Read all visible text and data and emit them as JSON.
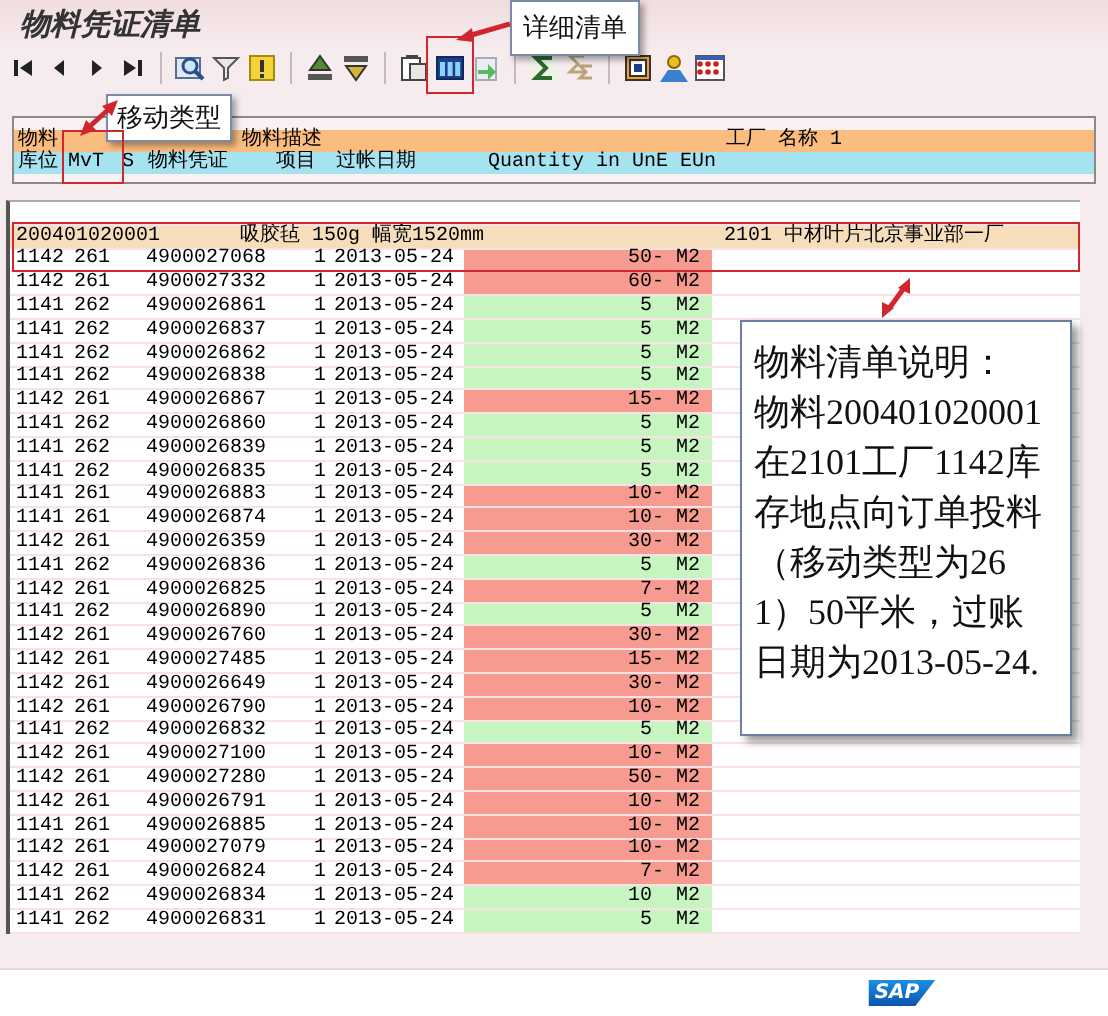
{
  "window": {
    "title": "物料凭证清单"
  },
  "toolbar": [
    {
      "kind": "first"
    },
    {
      "kind": "prev"
    },
    {
      "kind": "next"
    },
    {
      "kind": "last"
    },
    {
      "kind": "separator"
    },
    {
      "kind": "find"
    },
    {
      "kind": "filter"
    },
    {
      "kind": "warning"
    },
    {
      "kind": "separator"
    },
    {
      "kind": "sort-up"
    },
    {
      "kind": "sort-down"
    },
    {
      "kind": "separator"
    },
    {
      "kind": "export"
    },
    {
      "kind": "columns"
    },
    {
      "kind": "refresh"
    },
    {
      "kind": "separator"
    },
    {
      "kind": "sum"
    },
    {
      "kind": "subtotal"
    },
    {
      "kind": "separator"
    },
    {
      "kind": "layout"
    },
    {
      "kind": "person"
    },
    {
      "kind": "grid"
    }
  ],
  "header": {
    "row_1": [
      "物料",
      "物料描述",
      "工厂 名称 1"
    ],
    "row_2": [
      "库位",
      "MvT",
      "S",
      "物料凭证",
      "项目",
      "过帐日期",
      "Quantity in UnE EUn"
    ]
  },
  "group": {
    "material": "200401020001",
    "description": "吸胶毡 150g 幅宽1520mm",
    "plant": "2101 中材叶片北京事业部一厂"
  },
  "rows": [
    {
      "storage_location": "1142",
      "movement_type": "261",
      "document": "4900027068",
      "item": "1",
      "posting_date": "2013-05-24",
      "quantity": "50-",
      "unit": "M2",
      "color": "#f79a8f"
    },
    {
      "storage_location": "1142",
      "movement_type": "261",
      "document": "4900027332",
      "item": "1",
      "posting_date": "2013-05-24",
      "quantity": "60-",
      "unit": "M2",
      "color": "#f79a8f"
    },
    {
      "storage_location": "1141",
      "movement_type": "262",
      "document": "4900026861",
      "item": "1",
      "posting_date": "2013-05-24",
      "quantity": "5",
      "unit": "M2",
      "color": "#c6f5c0"
    },
    {
      "storage_location": "1141",
      "movement_type": "262",
      "document": "4900026837",
      "item": "1",
      "posting_date": "2013-05-24",
      "quantity": "5",
      "unit": "M2",
      "color": "#c6f5c0"
    },
    {
      "storage_location": "1141",
      "movement_type": "262",
      "document": "4900026862",
      "item": "1",
      "posting_date": "2013-05-24",
      "quantity": "5",
      "unit": "M2",
      "color": "#c6f5c0"
    },
    {
      "storage_location": "1141",
      "movement_type": "262",
      "document": "4900026838",
      "item": "1",
      "posting_date": "2013-05-24",
      "quantity": "5",
      "unit": "M2",
      "color": "#c6f5c0"
    },
    {
      "storage_location": "1142",
      "movement_type": "261",
      "document": "4900026867",
      "item": "1",
      "posting_date": "2013-05-24",
      "quantity": "15-",
      "unit": "M2",
      "color": "#f79a8f"
    },
    {
      "storage_location": "1141",
      "movement_type": "262",
      "document": "4900026860",
      "item": "1",
      "posting_date": "2013-05-24",
      "quantity": "5",
      "unit": "M2",
      "color": "#c6f5c0"
    },
    {
      "storage_location": "1141",
      "movement_type": "262",
      "document": "4900026839",
      "item": "1",
      "posting_date": "2013-05-24",
      "quantity": "5",
      "unit": "M2",
      "color": "#c6f5c0"
    },
    {
      "storage_location": "1141",
      "movement_type": "262",
      "document": "4900026835",
      "item": "1",
      "posting_date": "2013-05-24",
      "quantity": "5",
      "unit": "M2",
      "color": "#c6f5c0"
    },
    {
      "storage_location": "1141",
      "movement_type": "261",
      "document": "4900026883",
      "item": "1",
      "posting_date": "2013-05-24",
      "quantity": "10-",
      "unit": "M2",
      "color": "#f79a8f"
    },
    {
      "storage_location": "1141",
      "movement_type": "261",
      "document": "4900026874",
      "item": "1",
      "posting_date": "2013-05-24",
      "quantity": "10-",
      "unit": "M2",
      "color": "#f79a8f"
    },
    {
      "storage_location": "1142",
      "movement_type": "261",
      "document": "4900026359",
      "item": "1",
      "posting_date": "2013-05-24",
      "quantity": "30-",
      "unit": "M2",
      "color": "#f79a8f"
    },
    {
      "storage_location": "1141",
      "movement_type": "262",
      "document": "4900026836",
      "item": "1",
      "posting_date": "2013-05-24",
      "quantity": "5",
      "unit": "M2",
      "color": "#c6f5c0"
    },
    {
      "storage_location": "1142",
      "movement_type": "261",
      "document": "4900026825",
      "item": "1",
      "posting_date": "2013-05-24",
      "quantity": "7-",
      "unit": "M2",
      "color": "#f79a8f"
    },
    {
      "storage_location": "1141",
      "movement_type": "262",
      "document": "4900026890",
      "item": "1",
      "posting_date": "2013-05-24",
      "quantity": "5",
      "unit": "M2",
      "color": "#c6f5c0"
    },
    {
      "storage_location": "1142",
      "movement_type": "261",
      "document": "4900026760",
      "item": "1",
      "posting_date": "2013-05-24",
      "quantity": "30-",
      "unit": "M2",
      "color": "#f79a8f"
    },
    {
      "storage_location": "1142",
      "movement_type": "261",
      "document": "4900027485",
      "item": "1",
      "posting_date": "2013-05-24",
      "quantity": "15-",
      "unit": "M2",
      "color": "#f79a8f"
    },
    {
      "storage_location": "1142",
      "movement_type": "261",
      "document": "4900026649",
      "item": "1",
      "posting_date": "2013-05-24",
      "quantity": "30-",
      "unit": "M2",
      "color": "#f79a8f"
    },
    {
      "storage_location": "1142",
      "movement_type": "261",
      "document": "4900026790",
      "item": "1",
      "posting_date": "2013-05-24",
      "quantity": "10-",
      "unit": "M2",
      "color": "#f79a8f"
    },
    {
      "storage_location": "1141",
      "movement_type": "262",
      "document": "4900026832",
      "item": "1",
      "posting_date": "2013-05-24",
      "quantity": "5",
      "unit": "M2",
      "color": "#c6f5c0"
    },
    {
      "storage_location": "1142",
      "movement_type": "261",
      "document": "4900027100",
      "item": "1",
      "posting_date": "2013-05-24",
      "quantity": "10-",
      "unit": "M2",
      "color": "#f79a8f"
    },
    {
      "storage_location": "1142",
      "movement_type": "261",
      "document": "4900027280",
      "item": "1",
      "posting_date": "2013-05-24",
      "quantity": "50-",
      "unit": "M2",
      "color": "#f79a8f"
    },
    {
      "storage_location": "1142",
      "movement_type": "261",
      "document": "4900026791",
      "item": "1",
      "posting_date": "2013-05-24",
      "quantity": "10-",
      "unit": "M2",
      "color": "#f79a8f"
    },
    {
      "storage_location": "1141",
      "movement_type": "261",
      "document": "4900026885",
      "item": "1",
      "posting_date": "2013-05-24",
      "quantity": "10-",
      "unit": "M2",
      "color": "#f79a8f"
    },
    {
      "storage_location": "1142",
      "movement_type": "261",
      "document": "4900027079",
      "item": "1",
      "posting_date": "2013-05-24",
      "quantity": "10-",
      "unit": "M2",
      "color": "#f79a8f"
    },
    {
      "storage_location": "1142",
      "movement_type": "261",
      "document": "4900026824",
      "item": "1",
      "posting_date": "2013-05-24",
      "quantity": "7-",
      "unit": "M2",
      "color": "#f79a8f"
    },
    {
      "storage_location": "1141",
      "movement_type": "262",
      "document": "4900026834",
      "item": "1",
      "posting_date": "2013-05-24",
      "quantity": "10",
      "unit": "M2",
      "color": "#c6f5c0"
    },
    {
      "storage_location": "1141",
      "movement_type": "262",
      "document": "4900026831",
      "item": "1",
      "posting_date": "2013-05-24",
      "quantity": "5",
      "unit": "M2",
      "color": "#c6f5c0"
    }
  ],
  "annotations": [
    {
      "kind": "callout",
      "text": "详细清单"
    },
    {
      "kind": "callout",
      "text": "移动类型"
    },
    {
      "kind": "note",
      "title": "物料清单说明：",
      "text": "物料200401020001在2101工厂1142库存地点向订单投料（移动类型为261）50平米，过账日期为2013-05-24."
    }
  ],
  "status_bar": {
    "logo": "SAP"
  }
}
